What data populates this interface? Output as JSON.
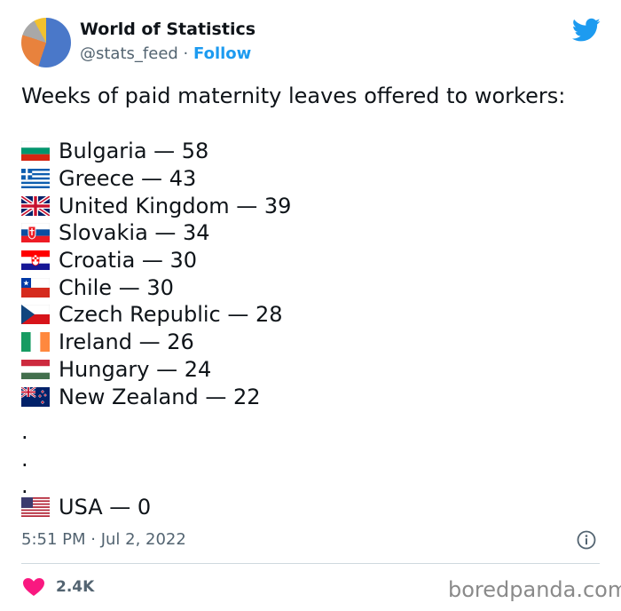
{
  "author": {
    "name": "World of Statistics",
    "handle": "@stats_feed",
    "separator": "·",
    "follow_label": "Follow"
  },
  "tweet": {
    "intro": "Weeks of paid maternity leaves offered to workers:",
    "countries": [
      {
        "text": "Bulgaria — 58",
        "flag": "bulgaria-flag-icon"
      },
      {
        "text": "Greece — 43",
        "flag": "greece-flag-icon"
      },
      {
        "text": "United Kingdom — 39",
        "flag": "uk-flag-icon"
      },
      {
        "text": "Slovakia — 34",
        "flag": "slovakia-flag-icon"
      },
      {
        "text": "Croatia — 30",
        "flag": "croatia-flag-icon"
      },
      {
        "text": "Chile — 30",
        "flag": "chile-flag-icon"
      },
      {
        "text": "Czech Republic — 28",
        "flag": "czech-flag-icon"
      },
      {
        "text": "Ireland — 26",
        "flag": "ireland-flag-icon"
      },
      {
        "text": "Hungary — 24",
        "flag": "hungary-flag-icon"
      },
      {
        "text": "New Zealand — 22",
        "flag": "new-zealand-flag-icon"
      }
    ],
    "ellipsis": ".",
    "last": {
      "text": "USA — 0",
      "flag": "usa-flag-icon"
    }
  },
  "footer": {
    "timestamp": "5:51 PM · Jul 2, 2022",
    "likes": "2.4K",
    "watermark": "boredpanda.com"
  },
  "colors": {
    "accent": "#1d9bf0",
    "heart": "#f91880",
    "muted": "#536471"
  }
}
